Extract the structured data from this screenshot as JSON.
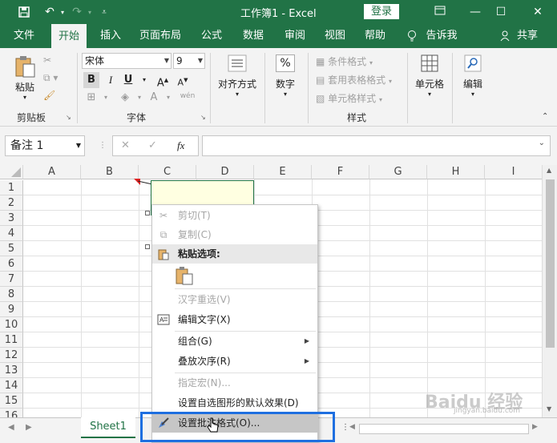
{
  "titlebar": {
    "title": "工作簿1  -  Excel",
    "login": "登录"
  },
  "tabs": [
    "文件",
    "开始",
    "插入",
    "页面布局",
    "公式",
    "数据",
    "审阅",
    "视图",
    "帮助",
    "告诉我",
    "共享"
  ],
  "ribbon": {
    "clipboard": {
      "paste": "粘贴",
      "label": "剪贴板"
    },
    "font": {
      "name": "宋体",
      "size": "9",
      "label": "字体",
      "bold": "B",
      "italic": "I",
      "underline": "U"
    },
    "alignment": {
      "label": "对齐方式"
    },
    "number": {
      "label": "数字",
      "symbol": "%"
    },
    "styles": {
      "conditional": "条件格式",
      "table": "套用表格格式",
      "cell": "单元格样式",
      "label": "样式"
    },
    "cells": {
      "label": "单元格"
    },
    "editing": {
      "label": "编辑"
    }
  },
  "formula_bar": {
    "namebox": "备注 1",
    "fx": "fx"
  },
  "grid": {
    "columns": [
      "A",
      "B",
      "C",
      "D",
      "E",
      "F",
      "G",
      "H",
      "I"
    ],
    "rows": [
      "1",
      "2",
      "3",
      "4",
      "5",
      "6",
      "7",
      "8",
      "9",
      "10",
      "11",
      "12",
      "13",
      "14",
      "15",
      "16"
    ]
  },
  "sheets": {
    "active": "Sheet1"
  },
  "context_menu": {
    "cut": "剪切(T)",
    "copy": "复制(C)",
    "paste_options": "粘贴选项:",
    "reconvert": "汉字重选(V)",
    "edit_text": "编辑文字(X)",
    "group": "组合(G)",
    "order": "叠放次序(R)",
    "macro": "指定宏(N)...",
    "default_shape": "设置自选图形的默认效果(D)",
    "format_comment": "设置批注格式(O)..."
  },
  "watermark": {
    "main": "Baidu 经验",
    "sub": "jingyan.baidu.com"
  },
  "colors": {
    "accent": "#217346",
    "highlight": "#1e6fe0",
    "comment_fill": "#ffffe1"
  }
}
